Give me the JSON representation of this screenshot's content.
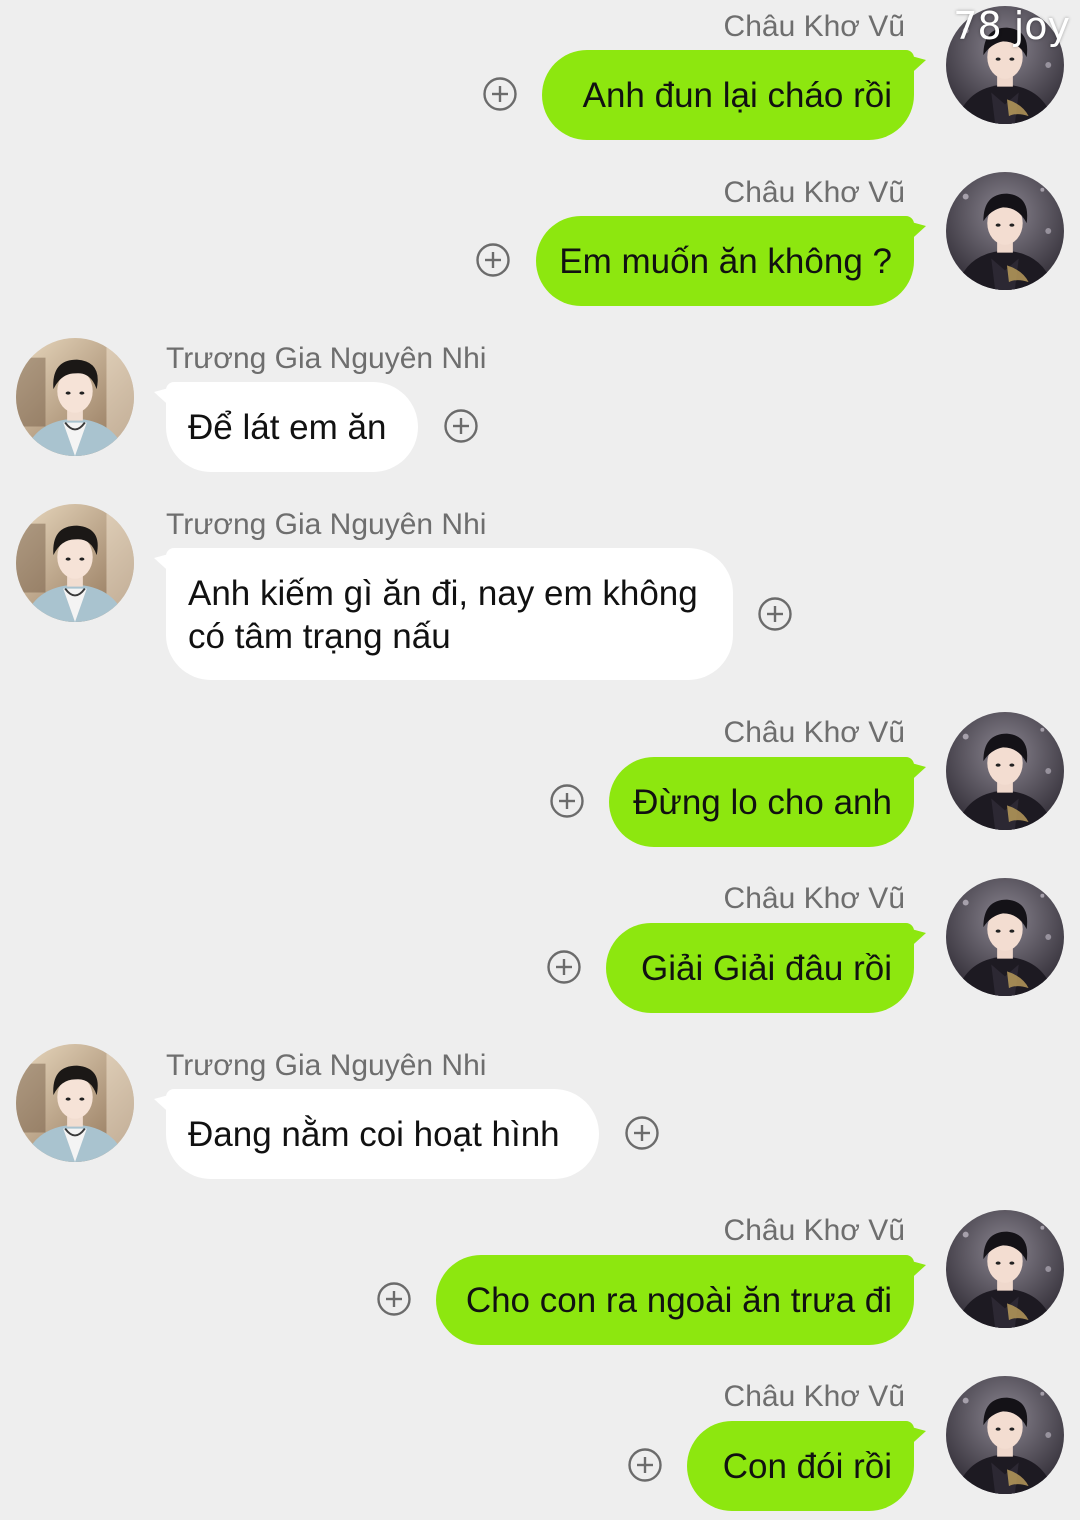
{
  "watermark": "78 joy",
  "colors": {
    "background": "#eeeeee",
    "my_bubble": "#8de70f",
    "their_bubble": "#ffffff",
    "sender_name": "#6e6e6e"
  },
  "contacts": {
    "me": "Châu Khơ Vũ",
    "other": "Trương Gia Nguyên Nhi"
  },
  "messages": [
    {
      "side": "me",
      "sender": "Châu Khơ Vũ",
      "text": "Anh đun lại cháo rồi"
    },
    {
      "side": "me",
      "sender": "Châu Khơ Vũ",
      "text": "Em muốn ăn không ?"
    },
    {
      "side": "other",
      "sender": "Trương Gia Nguyên Nhi",
      "text": "Để lát em ăn"
    },
    {
      "side": "other",
      "sender": "Trương Gia Nguyên Nhi",
      "text": "Anh kiếm gì ăn đi, nay em không có tâm trạng nấu"
    },
    {
      "side": "me",
      "sender": "Châu Khơ Vũ",
      "text": "Đừng lo cho anh"
    },
    {
      "side": "me",
      "sender": "Châu Khơ Vũ",
      "text": "Giải Giải đâu rồi"
    },
    {
      "side": "other",
      "sender": "Trương Gia Nguyên Nhi",
      "text": "Đang nằm coi hoạt hình"
    },
    {
      "side": "me",
      "sender": "Châu Khơ Vũ",
      "text": "Cho con ra ngoài ăn trưa đi"
    },
    {
      "side": "me",
      "sender": "Châu Khơ Vũ",
      "text": "Con đói rồi"
    }
  ],
  "icons": {
    "add_reaction": "plus-circle-icon",
    "my_avatar": "avatar-dark-outfit",
    "other_avatar": "avatar-light-blue-blazer"
  }
}
